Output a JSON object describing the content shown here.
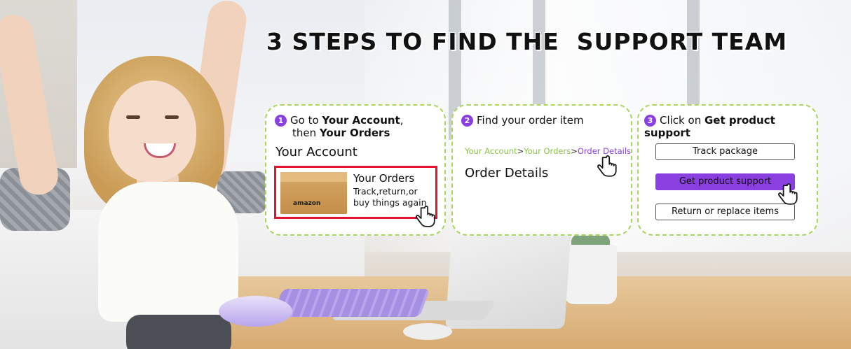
{
  "headline": "3 STEPS TO FIND THE  SUPPORT TEAM",
  "step1": {
    "number": "1",
    "text_prefix": "Go to ",
    "text_bold1": "Your Account",
    "text_comma": ",",
    "text_then": "then ",
    "text_bold2": "Your Orders",
    "heading": "Your Account",
    "box_logo": "amazon",
    "orders_title": "Your Orders",
    "orders_subtitle": "Track,return,or buy things again"
  },
  "step2": {
    "number": "2",
    "title": "Find your order item",
    "breadcrumb": [
      "Your Account",
      ">",
      "Your Orders",
      ">",
      "Order Details"
    ],
    "heading": "Order Details"
  },
  "step3": {
    "number": "3",
    "title_prefix": "Click on ",
    "title_bold": "Get product support",
    "buttons": [
      "Track package",
      "Get product support",
      "Return  or replace items"
    ]
  },
  "colors": {
    "accent_purple": "#8a3fe0",
    "highlight_red": "#e3142f",
    "breadcrumb_green": "#8bc34a",
    "card_border_green": "#a8d65f"
  },
  "icons": [
    "pointer-hand-icon"
  ]
}
